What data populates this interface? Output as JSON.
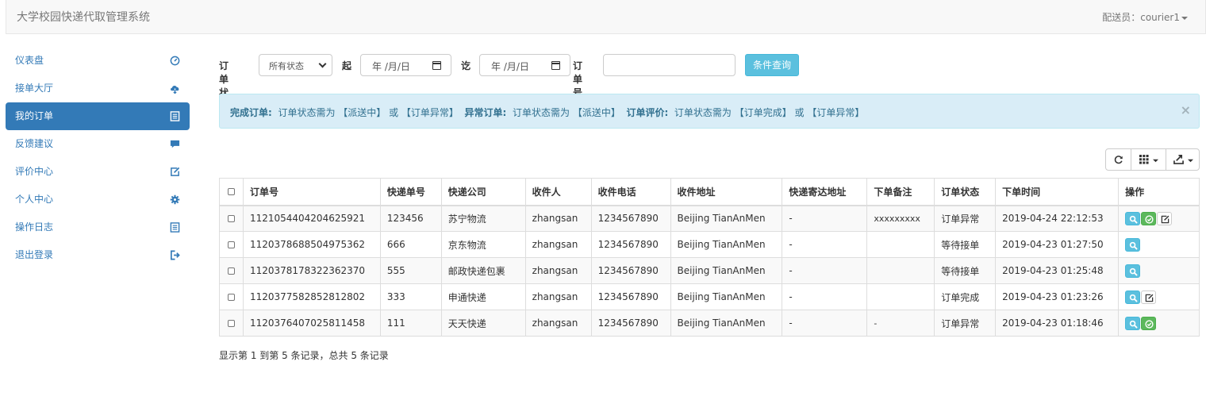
{
  "navbar": {
    "brand": "大学校园快递代取管理系统",
    "user": "配送员：courier1"
  },
  "sidebar": {
    "items": [
      {
        "label": "仪表盘",
        "icon": "dashboard-icon"
      },
      {
        "label": "接单大厅",
        "icon": "cloud-download-icon"
      },
      {
        "label": "我的订单",
        "icon": "list-icon",
        "active": true
      },
      {
        "label": "反馈建议",
        "icon": "comment-icon"
      },
      {
        "label": "评价中心",
        "icon": "edit-icon"
      },
      {
        "label": "个人中心",
        "icon": "gear-icon"
      },
      {
        "label": "操作日志",
        "icon": "list-icon"
      },
      {
        "label": "退出登录",
        "icon": "logout-icon"
      }
    ]
  },
  "filter": {
    "status_label": "订单状态",
    "status_value": "所有状态",
    "from_label": "起",
    "from_value": "年 /月/日",
    "to_label": "讫",
    "to_value": "年 /月/日",
    "order_label": "订单号",
    "order_value": "",
    "query_button": "条件查询"
  },
  "alert": {
    "k1": "完成订单:",
    "v1": "订单状态需为 【派送中】 或 【订单异常】",
    "k2": "异常订单:",
    "v2": "订单状态需为 【派送中】",
    "k3": "订单评价:",
    "v3": "订单状态需为 【订单完成】 或 【订单异常】",
    "close": "×"
  },
  "table": {
    "headers": [
      "订单号",
      "快递单号",
      "快递公司",
      "收件人",
      "收件电话",
      "收件地址",
      "快递寄达地址",
      "下单备注",
      "订单状态",
      "下单时间",
      "操作"
    ],
    "rows": [
      {
        "order_no": "1121054404204625921",
        "tracking": "123456",
        "company": "苏宁物流",
        "recipient": "zhangsan",
        "phone": "1234567890",
        "address": "Beijing TianAnMen",
        "arrive": "-",
        "remark": "xxxxxxxxx",
        "status": "订单异常",
        "time": "2019-04-24 22:12:53"
      },
      {
        "order_no": "1120378688504975362",
        "tracking": "666",
        "company": "京东物流",
        "recipient": "zhangsan",
        "phone": "1234567890",
        "address": "Beijing TianAnMen",
        "arrive": "-",
        "remark": "",
        "status": "等待接单",
        "time": "2019-04-23 01:27:50"
      },
      {
        "order_no": "1120378178322362370",
        "tracking": "555",
        "company": "邮政快递包裹",
        "recipient": "zhangsan",
        "phone": "1234567890",
        "address": "Beijing TianAnMen",
        "arrive": "-",
        "remark": "",
        "status": "等待接单",
        "time": "2019-04-23 01:25:48"
      },
      {
        "order_no": "1120377582852812802",
        "tracking": "333",
        "company": "申通快递",
        "recipient": "zhangsan",
        "phone": "1234567890",
        "address": "Beijing TianAnMen",
        "arrive": "-",
        "remark": "",
        "status": "订单完成",
        "time": "2019-04-23 01:23:26"
      },
      {
        "order_no": "1120376407025811458",
        "tracking": "111",
        "company": "天天快递",
        "recipient": "zhangsan",
        "phone": "1234567890",
        "address": "Beijing TianAnMen",
        "arrive": "-",
        "remark": "-",
        "status": "订单异常",
        "time": "2019-04-23 01:18:46"
      }
    ]
  },
  "summary": "显示第 1 到第 5 条记录，总共 5 条记录",
  "colors": {
    "primary": "#337ab7",
    "info": "#5bc0de",
    "success": "#5cb85c",
    "danger": "#d9534f",
    "alert_bg": "#d9edf7"
  }
}
